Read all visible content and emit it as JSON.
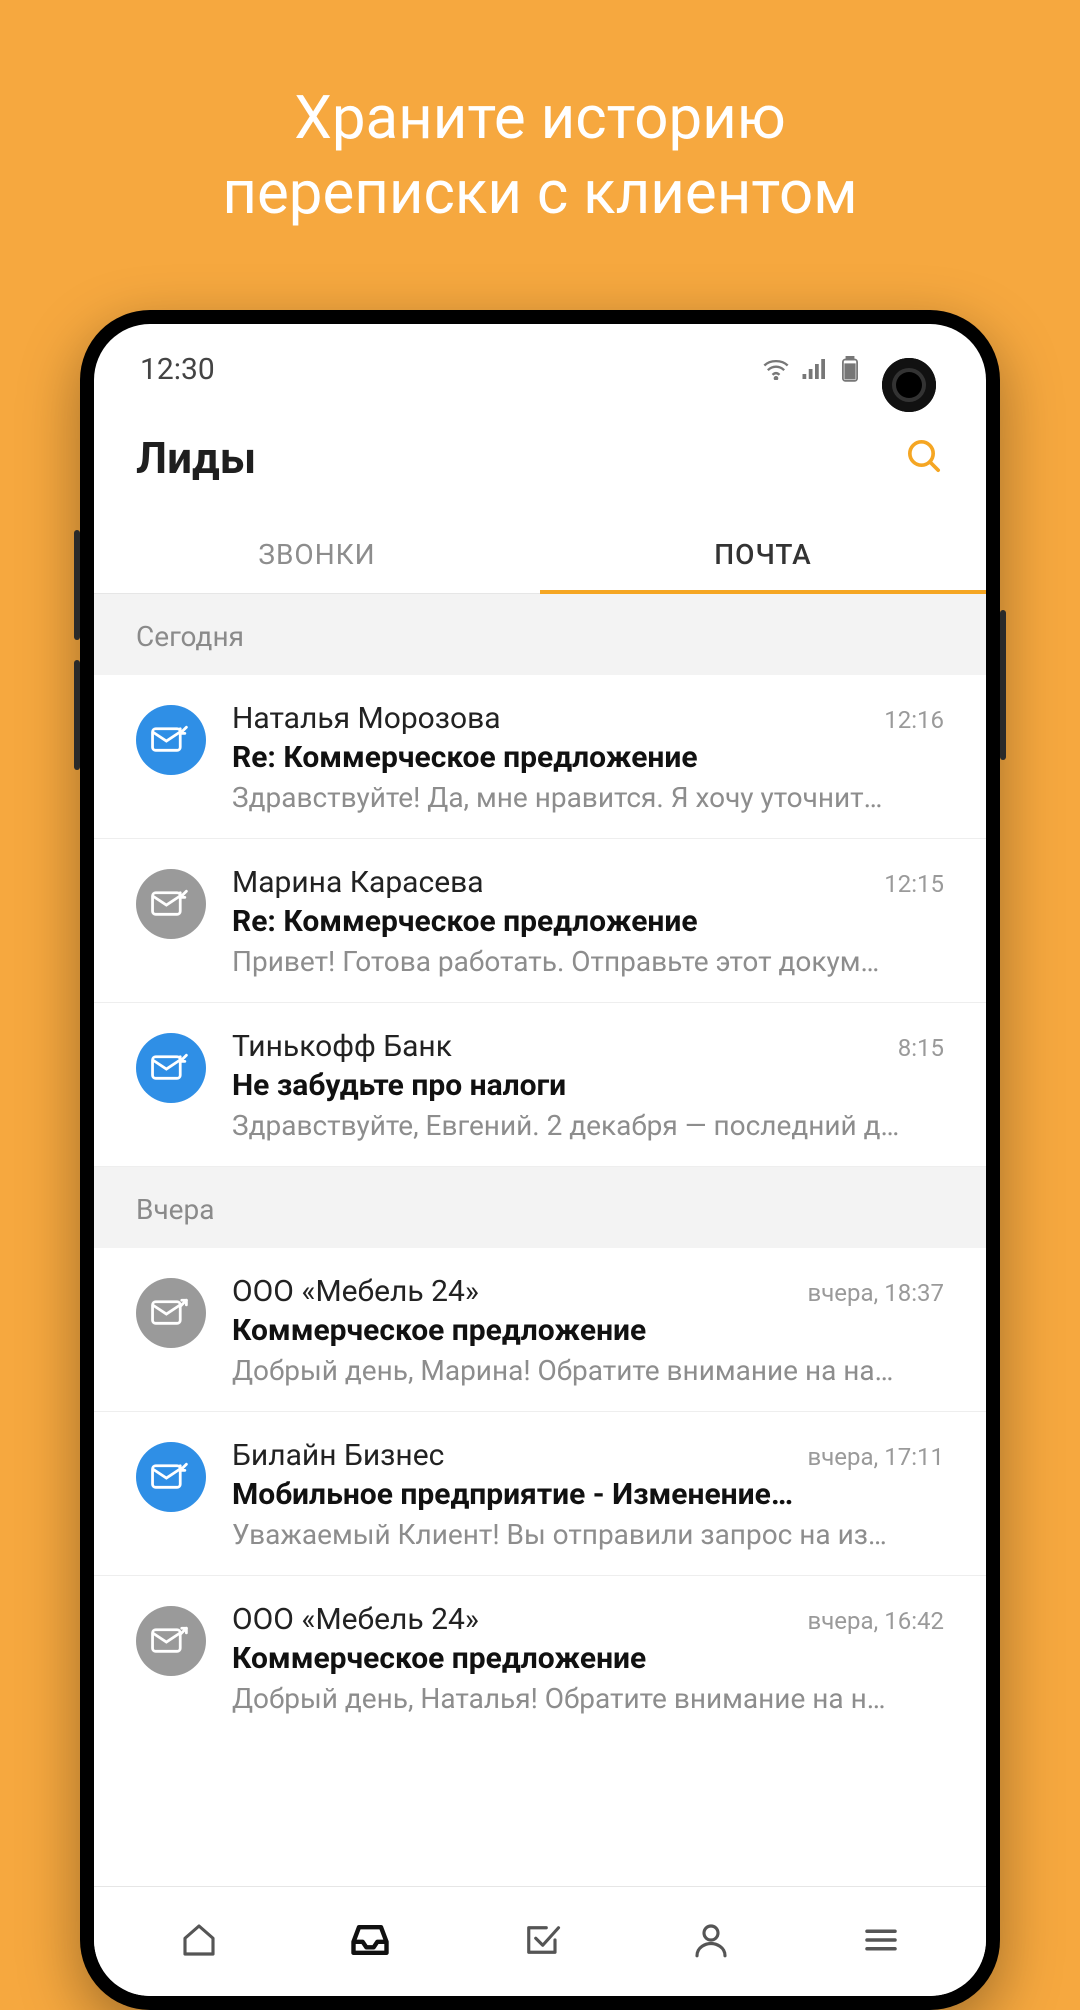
{
  "promo": {
    "line1": "Храните историю",
    "line2": "переписки с клиентом"
  },
  "status": {
    "time": "12:30"
  },
  "header": {
    "title": "Лиды"
  },
  "tabs": {
    "calls": "ЗВОНКИ",
    "mail": "ПОЧТА",
    "active": "mail"
  },
  "sections": [
    {
      "title": "Сегодня",
      "items": [
        {
          "icon": "mail-in",
          "icon_color": "blue",
          "sender": "Наталья Морозова",
          "time": "12:16",
          "subject": "Re: Коммерческое предложение",
          "preview": "Здравствуйте! Да, мне нравится. Я хочу уточнит…"
        },
        {
          "icon": "mail-in",
          "icon_color": "gray",
          "sender": "Марина Карасева",
          "time": "12:15",
          "subject": "Re: Коммерческое предложение",
          "preview": "Привет! Готова работать. Отправьте этот докум…"
        },
        {
          "icon": "mail-in",
          "icon_color": "blue",
          "sender": "Тинькофф Банк",
          "time": "8:15",
          "subject": "Не забудьте про налоги",
          "preview": "Здравствуйте, Евгений. 2 декабря — последний д…"
        }
      ]
    },
    {
      "title": "Вчера",
      "items": [
        {
          "icon": "mail-out",
          "icon_color": "gray",
          "sender": "ООО «Мебель 24»",
          "time": "вчера, 18:37",
          "subject": "Коммерческое предложение",
          "preview": "Добрый день, Марина! Обратите внимание на на…"
        },
        {
          "icon": "mail-in",
          "icon_color": "blue",
          "sender": "Билайн Бизнес",
          "time": "вчера, 17:11",
          "subject": "Мобильное предприятие - Изменение…",
          "preview": "Уважаемый Клиент! Вы отправили запрос на из…"
        },
        {
          "icon": "mail-out",
          "icon_color": "gray",
          "sender": "ООО «Мебель 24»",
          "time": "вчера, 16:42",
          "subject": "Коммерческое предложение",
          "preview": "Добрый день, Наталья! Обратите внимание на н…"
        }
      ]
    }
  ],
  "nav": {
    "items": [
      "home",
      "inbox",
      "tasks",
      "profile",
      "menu"
    ],
    "active": "inbox"
  }
}
